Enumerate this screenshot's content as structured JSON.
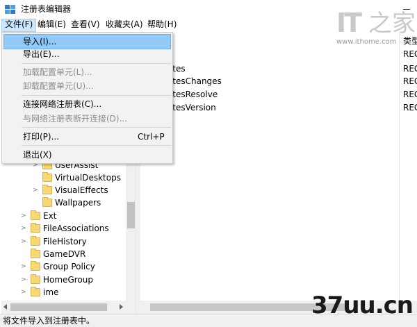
{
  "window": {
    "title": "注册表编辑器",
    "minimize_label": "—"
  },
  "menubar": {
    "items": [
      {
        "label": "文件(F)"
      },
      {
        "label": "编辑(E)"
      },
      {
        "label": "查看(V)"
      },
      {
        "label": "收藏夹(A)"
      },
      {
        "label": "帮助(H)"
      }
    ]
  },
  "file_menu": {
    "items": [
      {
        "label": "导入(I)...",
        "shortcut": "",
        "enabled": true,
        "highlighted": true
      },
      {
        "label": "导出(E)...",
        "shortcut": "",
        "enabled": true,
        "highlighted": false
      },
      {
        "label": "加载配置单元(L)...",
        "shortcut": "",
        "enabled": false,
        "highlighted": false
      },
      {
        "label": "卸载配置单元(U)...",
        "shortcut": "",
        "enabled": false,
        "highlighted": false
      },
      {
        "label": "连接网络注册表(C)...",
        "shortcut": "",
        "enabled": true,
        "highlighted": false
      },
      {
        "label": "与网络注册表断开连接(D)...",
        "shortcut": "",
        "enabled": false,
        "highlighted": false
      },
      {
        "label": "打印(P)...",
        "shortcut": "Ctrl+P",
        "enabled": true,
        "highlighted": false
      },
      {
        "label": "退出(X)",
        "shortcut": "",
        "enabled": true,
        "highlighted": false
      }
    ]
  },
  "tree": {
    "items": [
      {
        "label": "UserAssist",
        "expandable": true
      },
      {
        "label": "VirtualDesktops",
        "expandable": false
      },
      {
        "label": "VisualEffects",
        "expandable": true
      },
      {
        "label": "Wallpapers",
        "expandable": false
      },
      {
        "label": "Ext",
        "expandable": true
      },
      {
        "label": "FileAssociations",
        "expandable": true
      },
      {
        "label": "FileHistory",
        "expandable": true
      },
      {
        "label": "GameDVR",
        "expandable": false
      },
      {
        "label": "Group Policy",
        "expandable": true
      },
      {
        "label": "HomeGroup",
        "expandable": true
      },
      {
        "label": "ime",
        "expandable": true
      }
    ]
  },
  "values_list": {
    "column_type_header": "类型",
    "rows": [
      {
        "name": ")",
        "type": "REG"
      },
      {
        "name": "rites",
        "type": "REG"
      },
      {
        "name": "ritesChanges",
        "type": "REG"
      },
      {
        "name": "ritesResolve",
        "type": "REG"
      },
      {
        "name": "ritesVersion",
        "type": "REG"
      }
    ]
  },
  "statusbar": {
    "text": "将文件导入到注册表中。"
  },
  "watermarks": {
    "logo_it": "IT",
    "logo_char": "之家",
    "logo_url": "www.ithome.com",
    "site": "37uu.cn"
  },
  "colors": {
    "menu_highlight": "#91c9f7",
    "menubar_active": "#cce8ff",
    "folder": "#f8d775"
  }
}
